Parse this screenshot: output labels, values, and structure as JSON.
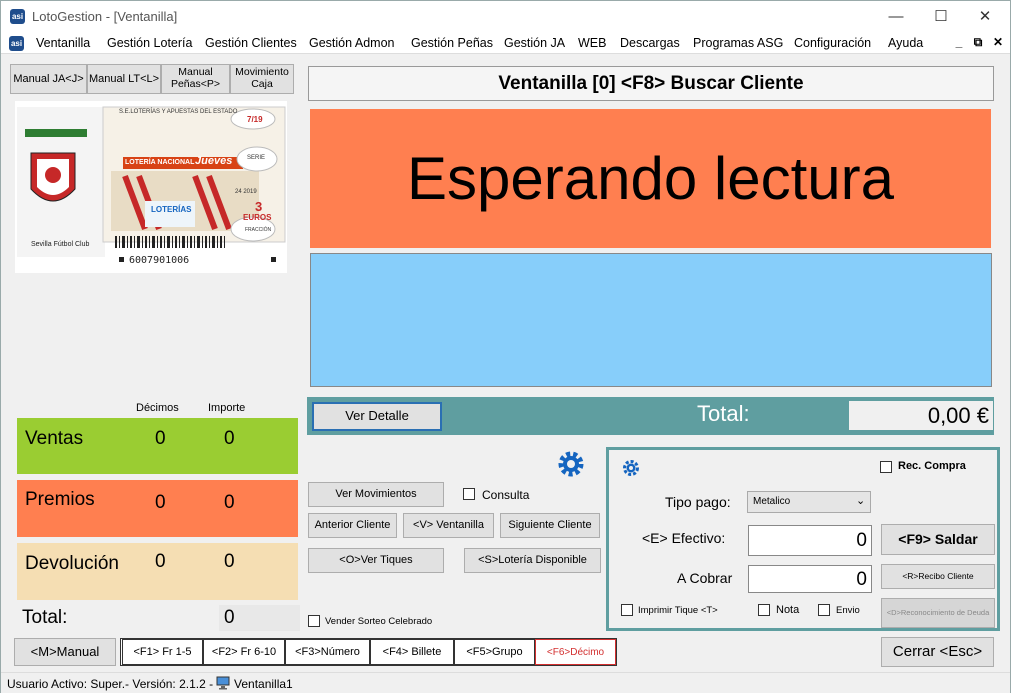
{
  "window": {
    "title": "LotoGestion - [Ventanilla]",
    "app_icon_text": "asi"
  },
  "menu": {
    "items": [
      "Ventanilla",
      "Gestión Lotería",
      "Gestión Clientes",
      "Gestión Admon",
      "Gestión Peñas",
      "Gestión JA",
      "WEB",
      "Descargas",
      "Programas ASG",
      "Configuración",
      "Ayuda"
    ]
  },
  "left_buttons": {
    "manual_ja": "Manual JA<J>",
    "manual_lt": "Manual LT<L>",
    "manual_penas": "Manual Peñas<P>",
    "movimiento_caja": "Movimiento Caja"
  },
  "ticket": {
    "entity": "S.E.LOTERÍAS Y APUESTAS DEL ESTADO",
    "draw": "7/19",
    "brand": "LOTERÍA NACIONAL",
    "day": "Jueves",
    "serie": "SERIE",
    "price": "3",
    "currency": "EUROS",
    "fraccion": "FRACCIÓN",
    "date": "24 2019",
    "loterias": "LOTERÍAS",
    "club": "Sevilla Fútbol Club",
    "barcode_number": "6007901006"
  },
  "stats": {
    "col_decimos": "Décimos",
    "col_importe": "Importe",
    "ventas": {
      "label": "Ventas",
      "decimos": "0",
      "importe": "0",
      "color": "#9acd32"
    },
    "premios": {
      "label": "Premios",
      "decimos": "0",
      "importe": "0",
      "color": "#ff7f50"
    },
    "devolucion": {
      "label": "Devolución",
      "decimos": "0",
      "importe": "0",
      "color": "#f5deb3"
    },
    "total_label": "Total:",
    "total_value": "0"
  },
  "header": {
    "title": "Ventanilla [0] <F8> Buscar Cliente"
  },
  "status_panel": {
    "text": "Esperando lectura",
    "color": "#ff7f50"
  },
  "info_panel": {
    "color": "#87cefa"
  },
  "total_bar": {
    "ver_detalle": "Ver Detalle",
    "label": "Total:",
    "value": "0,00 €",
    "color": "#5f9ea0"
  },
  "actions": {
    "ver_movimientos": "Ver Movimientos",
    "consulta": "Consulta",
    "anterior_cliente": "Anterior Cliente",
    "ventanilla": "<V> Ventanilla",
    "siguiente_cliente": "Siguiente Cliente",
    "ver_tiques": "<O>Ver Tiques",
    "loteria_disponible": "<S>Lotería Disponible",
    "vender_sorteo": "Vender Sorteo Celebrado"
  },
  "payment": {
    "rec_compra": "Rec. Compra",
    "tipo_pago_label": "Tipo pago:",
    "tipo_pago_value": "Metalico",
    "efectivo_label": "<E> Efectivo:",
    "efectivo_value": "0",
    "a_cobrar_label": "A Cobrar",
    "a_cobrar_value": "0",
    "saldar": "<F9> Saldar",
    "recibo_cliente": "<R>Recibo Cliente",
    "imprimir_tique": "Imprimir Tique <T>",
    "nota": "Nota",
    "envio": "Envio",
    "reconocimiento_deuda": "<D>Reconocimiento de Deuda"
  },
  "bottom": {
    "manual": "<M>Manual",
    "tabs": [
      "<F1> Fr 1-5",
      "<F2> Fr 6-10",
      "<F3>Número",
      "<F4> Billete",
      "<F5>Grupo",
      "<F6>Décimo"
    ],
    "cerrar": "Cerrar <Esc>"
  },
  "statusbar": {
    "user": "Usuario Activo: Super.- Versión: 2.1.2 -",
    "ventanilla": "Ventanilla1"
  }
}
